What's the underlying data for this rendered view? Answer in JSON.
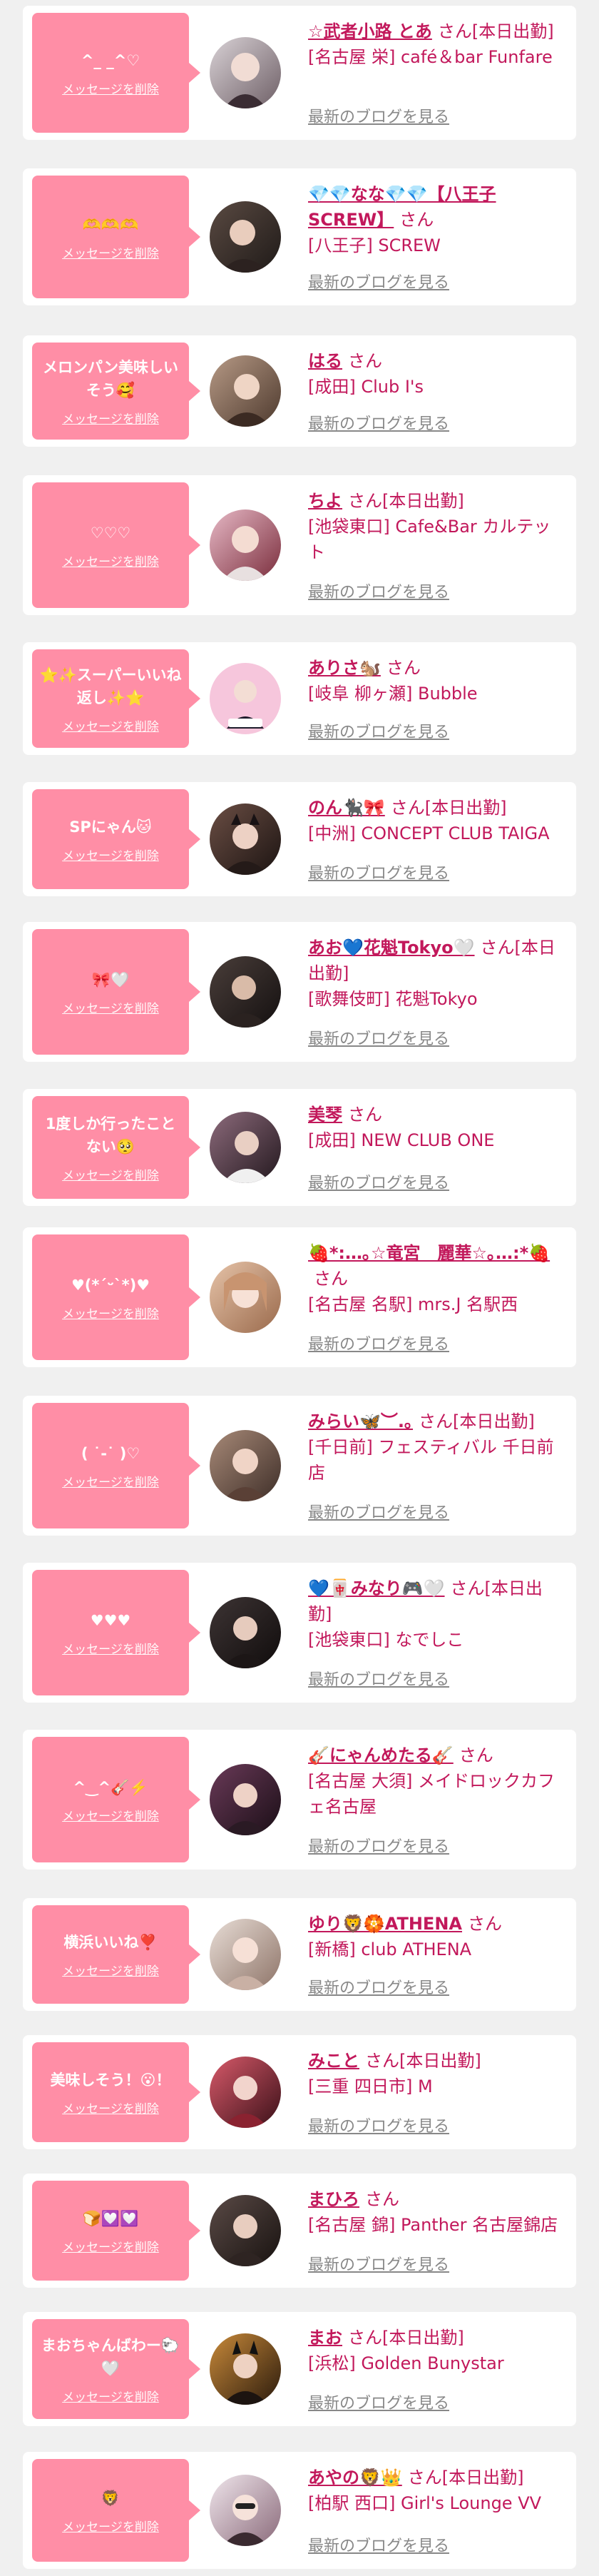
{
  "delete_label": "メッセージを削除",
  "blog_label": "最新のブログを見る",
  "san_suffix": "さん",
  "colors": {
    "accent": "#c2185b",
    "message_bg": "#ff8ea6",
    "background": "#f0f0f0"
  },
  "items": [
    {
      "message": "^_ _^♡",
      "name": "☆武者小路 とあ",
      "status": "[本日出勤]",
      "shop": "[名古屋 栄] café＆bar Funfare"
    },
    {
      "message": "🫶🫶🫶",
      "name": "💎💎なな💎💎【八王子SCREW】",
      "status": "",
      "shop": "[八王子] SCREW"
    },
    {
      "message": "メロンパン美味しいそう🥰",
      "name": "はる",
      "status": "",
      "shop": "[成田] Club I's"
    },
    {
      "message": "♡♡♡",
      "name": "ちよ",
      "status": "[本日出勤]",
      "shop": "[池袋東口] Cafe&Bar カルテット"
    },
    {
      "message": "⭐️✨スーパーいいね返し✨⭐️",
      "name": "ありさ🐿️",
      "status": "",
      "shop": "[岐阜 柳ヶ瀬] Bubble"
    },
    {
      "message": "SPにゃん🐱",
      "name": "のん🐈‍⬛🎀",
      "status": "[本日出勤]",
      "shop": "[中洲] CONCEPT CLUB TAIGA"
    },
    {
      "message": "🎀🤍",
      "name": "あお💙花魁Tokyo🤍",
      "status": "[本日出勤]",
      "shop": "[歌舞伎町] 花魁Tokyo"
    },
    {
      "message": "1度しか行ったことない🥺",
      "name": "美琴",
      "status": "",
      "shop": "[成田] NEW CLUB ONE"
    },
    {
      "message": "♥(*´ᵕ`*)♥",
      "name": "🍓*:…｡☆竜宮　麗華☆｡…:*🍓",
      "status": "",
      "shop": "[名古屋 名駅] mrs.J 名駅西"
    },
    {
      "message": "( ˙-˙ )♡",
      "name": "みらい🦋︶.｡",
      "status": "[本日出勤]",
      "shop": "[千日前] フェスティバル 千日前店"
    },
    {
      "message": "♥♥♥",
      "name": "💙🀄️みなり🎮🤍",
      "status": "[本日出勤]",
      "shop": "[池袋東口] なでしこ"
    },
    {
      "message": "^‿^🎸⚡️",
      "name": "🎸にゃんめたる🎸",
      "status": "",
      "shop": "[名古屋 大須] メイドロックカフェ名古屋"
    },
    {
      "message": "横浜いいね❣️",
      "name": "ゆり🦁🏵️ATHENA",
      "status": "",
      "shop": "[新橋] club ATHENA"
    },
    {
      "message": "美味しそう！😮！",
      "name": "みこと",
      "status": "[本日出勤]",
      "shop": "[三重 四日市] M"
    },
    {
      "message": "🍞💟💟",
      "name": "まひろ",
      "status": "",
      "shop": "[名古屋 錦] Panther 名古屋錦店"
    },
    {
      "message": "まおちゃんばわー🐑🤍",
      "name": "まお",
      "status": "[本日出勤]",
      "shop": "[浜松] Golden Bunystar"
    },
    {
      "message": "🦁",
      "name": "あやの🦁👑",
      "status": "[本日出勤]",
      "shop": "[柏駅 西口] Girl's Lounge VV"
    }
  ]
}
